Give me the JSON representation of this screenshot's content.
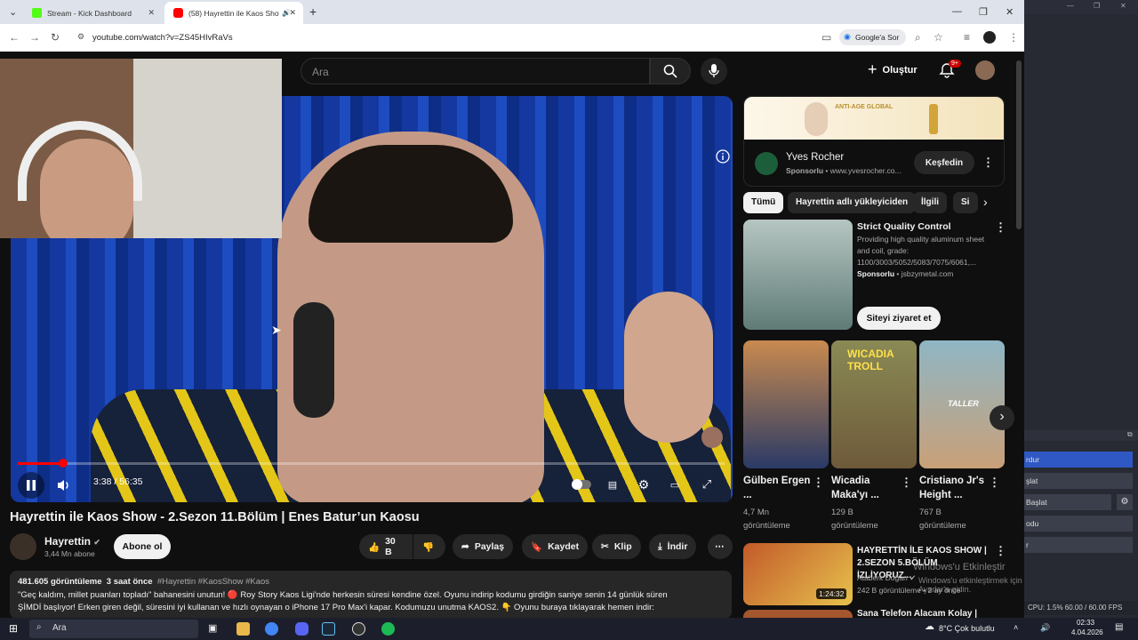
{
  "browser": {
    "tabs": [
      {
        "title": "Stream - Kick Dashboard",
        "color": "#53fc18"
      },
      {
        "title": "(58) Hayrettin ile Kaos Show",
        "color": "#ff0000"
      }
    ],
    "url": "youtube.com/watch?v=ZS45HIvRaVs",
    "google_sor": "Google'a Sor"
  },
  "header": {
    "search_placeholder": "Ara",
    "create_label": "Oluştur",
    "notif_count": "9+"
  },
  "player": {
    "current_time": "3:38",
    "duration": "56:35",
    "time_display": "3:38 / 56:35",
    "progress_fraction": 0.064
  },
  "video": {
    "title": "Hayrettin ile Kaos Show - 2.Sezon 11.Bölüm | Enes Batur’un Kaosu",
    "channel": "Hayrettin",
    "subscribers": "3,44 Mn abone",
    "subscribe_label": "Abone ol",
    "likes": "30 B",
    "share_label": "Paylaş",
    "save_label": "Kaydet",
    "clip_label": "Klip",
    "download_label": "İndir",
    "views": "481.605 görüntüleme",
    "posted": "3 saat önce",
    "tags": "#Hayrettin #KaosShow #Kaos",
    "desc_line1": "\"Geç kaldım, millet puanları topladı\" bahanesini unutun! 🔴 Roy Story Kaos Ligi'nde herkesin süresi kendine özel. Oyunu indirip kodumu girdiğin saniye senin 14 günlük süren",
    "desc_line2": "ŞİMDİ başlıyor! Erken giren değil, süresini iyi kullanan ve hızlı oynayan o iPhone 17 Pro Max'i kapar. Kodumuzu unutma KAOS2. 👇 Oyunu buraya tıklayarak hemen indir:"
  },
  "ad": {
    "banner_text": "ANTI-AGE GLOBAL",
    "brand": "Yves Rocher",
    "sponsored": "Sponsorlu",
    "domain": "www.yvesrocher.co...",
    "cta": "Keşfedin"
  },
  "chips": [
    "Tümü",
    "Hayrettin adlı yükleyiciden",
    "İlgili",
    "Si"
  ],
  "sponsored_card": {
    "title": "Strict Quality Control",
    "desc": "Providing high quality aluminum sheet and coil, grade: 1100/3003/5052/5083/7075/6061,...",
    "sponsored": "Sponsorlu",
    "domain": "jsbzymetal.com",
    "cta": "Siteyi ziyaret et"
  },
  "shorts": [
    {
      "title": "Gülben Ergen ...",
      "views": "4,7 Mn",
      "views_label": "görüntüleme"
    },
    {
      "title": "Wicadia Maka'yı ...",
      "views": "129 B",
      "views_label": "görüntüleme",
      "overlay": "WICADIA TROLL"
    },
    {
      "title": "Cristiano Jr's Height ...",
      "views": "767 B",
      "views_label": "görüntüleme",
      "overlay": "TALLER"
    }
  ],
  "related": [
    {
      "title": "HAYRETTİN İLE KAOS SHOW | 2.SEZON 5.BÖLÜM İZLİYORUZ...",
      "channel": "Ataberk Doğan",
      "meta": "242 B görüntüleme • 2 ay önce",
      "duration": "1:24:32"
    },
    {
      "title": "Sana Telefon Alacam Kolay |",
      "channel": "",
      "meta": "",
      "duration": ""
    }
  ],
  "watermark": {
    "line1": "Windows'u Etkinleştir",
    "line2": "Windows'u etkinleştirmek için Ayarlar'a gidin."
  },
  "obs": {
    "items": [
      "rdur",
      "şlat",
      "Başlat",
      "odu",
      "r"
    ],
    "status": "CPU: 1.5%   60.00 / 60.00 FPS"
  },
  "taskbar": {
    "search": "Ara",
    "weather": "8°C  Çok bulutlu",
    "time": "02:33",
    "date": "4.04.2026"
  },
  "colors": {
    "accent": "#ff0000",
    "bg": "#0f0f0f",
    "pill": "#272727"
  }
}
